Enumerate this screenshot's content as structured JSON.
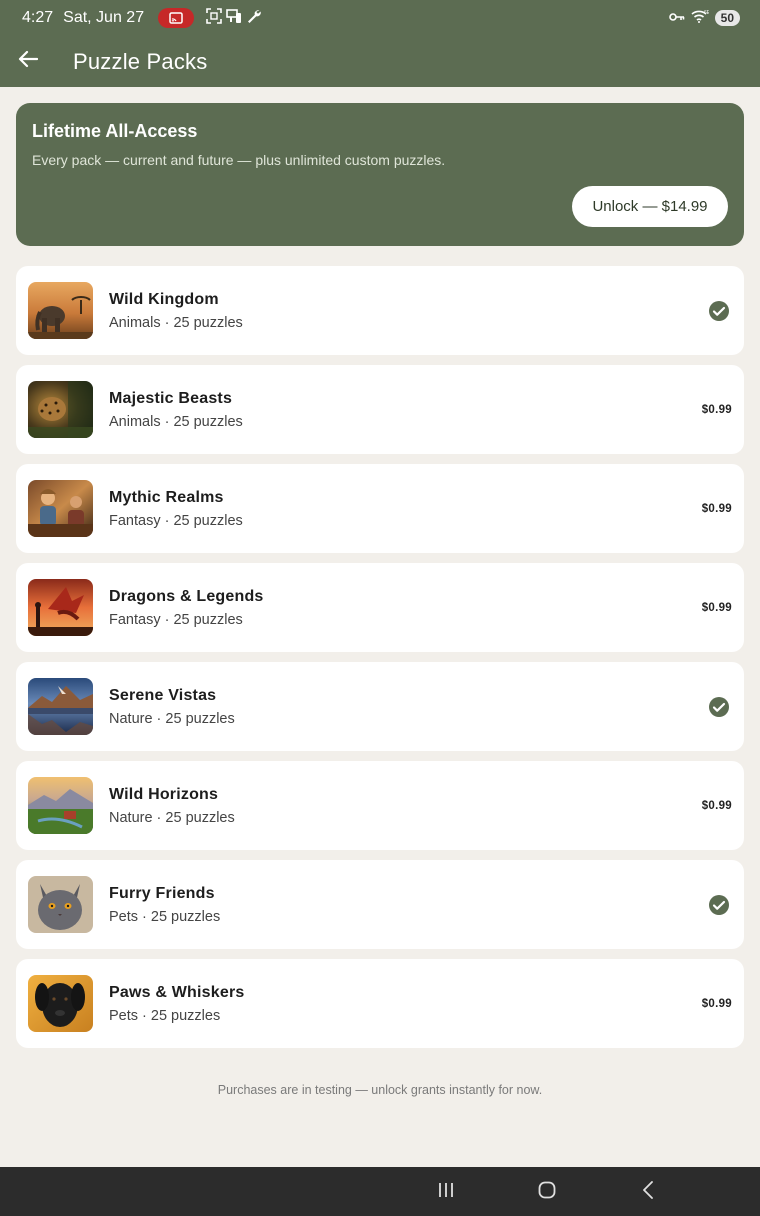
{
  "status_bar": {
    "time": "4:27",
    "date": "Sat, Jun 27",
    "battery": "50",
    "icons": [
      "cast-icon",
      "screenshot-icon",
      "device-icon",
      "wrench-icon",
      "vpn-key-icon",
      "wifi-icon",
      "battery-icon"
    ]
  },
  "app_bar": {
    "title": "Puzzle Packs",
    "back_icon": "arrow-left-icon"
  },
  "banner": {
    "title": "Lifetime All-Access",
    "subtitle": "Every pack — current and future — plus unlimited custom puzzles.",
    "button_label": "Unlock — $14.99"
  },
  "packs": [
    {
      "name": "Wild Kingdom",
      "meta": "Animals · 25 puzzles",
      "owned": true,
      "price": ""
    },
    {
      "name": "Majestic Beasts",
      "meta": "Animals · 25 puzzles",
      "owned": false,
      "price": "$0.99"
    },
    {
      "name": "Mythic Realms",
      "meta": "Fantasy · 25 puzzles",
      "owned": false,
      "price": "$0.99"
    },
    {
      "name": "Dragons & Legends",
      "meta": "Fantasy · 25 puzzles",
      "owned": false,
      "price": "$0.99"
    },
    {
      "name": "Serene Vistas",
      "meta": "Nature · 25 puzzles",
      "owned": true,
      "price": ""
    },
    {
      "name": "Wild Horizons",
      "meta": "Nature · 25 puzzles",
      "owned": false,
      "price": "$0.99"
    },
    {
      "name": "Furry Friends",
      "meta": "Pets · 25 puzzles",
      "owned": true,
      "price": ""
    },
    {
      "name": "Paws & Whiskers",
      "meta": "Pets · 25 puzzles",
      "owned": false,
      "price": "$0.99"
    }
  ],
  "footer_note": "Purchases are in testing — unlock grants instantly for now.",
  "colors": {
    "primary": "#5c6c52",
    "background": "#f2efea",
    "card": "#ffffff",
    "cast_pill": "#c62828",
    "nav_bar": "#2c2c2c"
  }
}
